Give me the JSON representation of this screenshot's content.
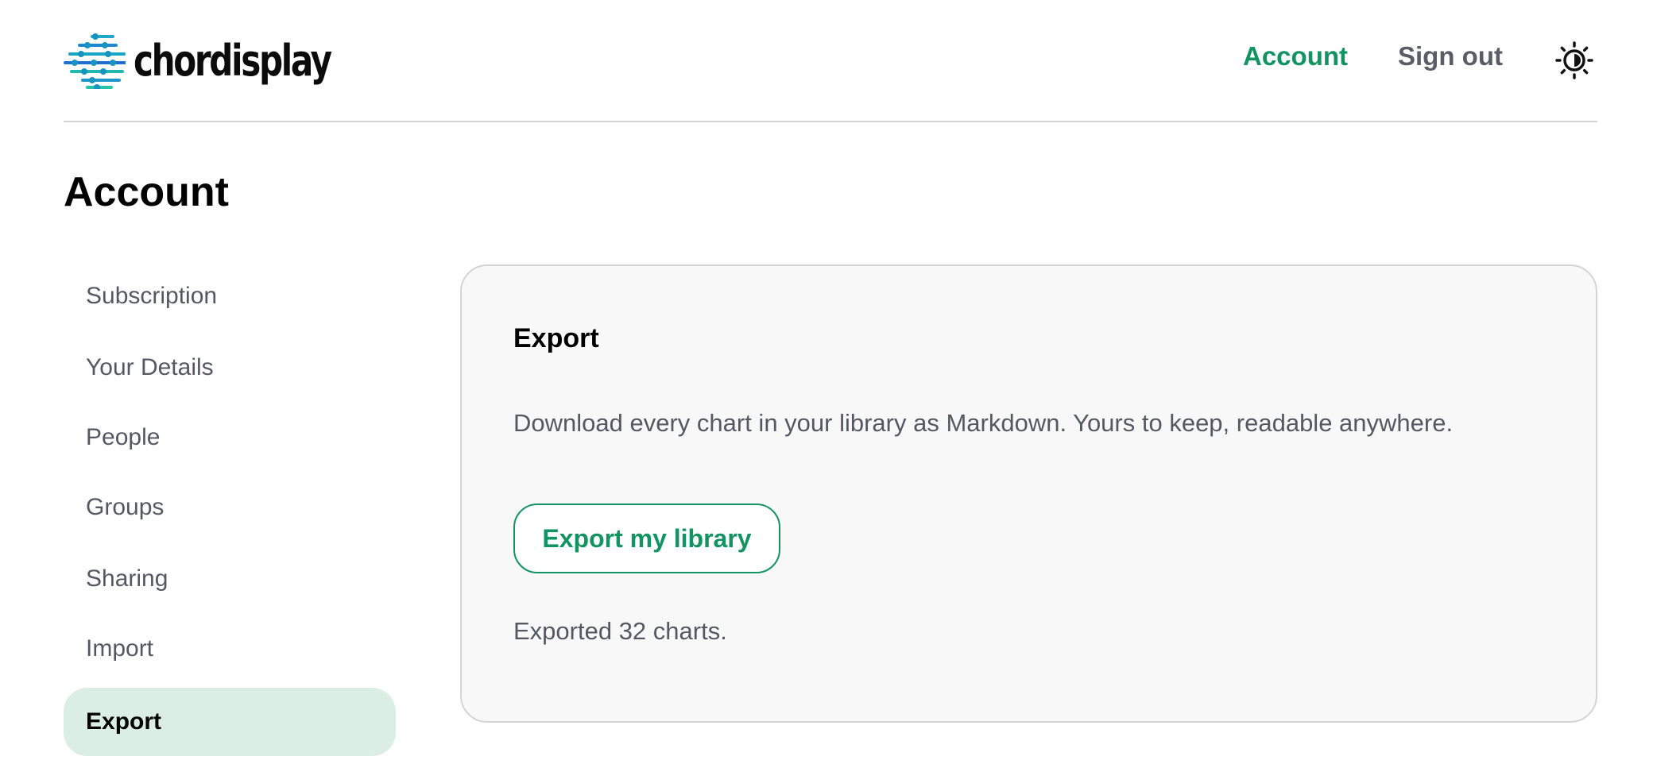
{
  "header": {
    "logo_text": "chordisplay",
    "logo_icon": "slider-lines-icon",
    "nav_account": "Account",
    "nav_signout": "Sign out",
    "theme_icon": "sun-moon-icon"
  },
  "page_title": "Account",
  "sidebar": {
    "items": [
      {
        "label": "Subscription",
        "active": false
      },
      {
        "label": "Your Details",
        "active": false
      },
      {
        "label": "People",
        "active": false
      },
      {
        "label": "Groups",
        "active": false
      },
      {
        "label": "Sharing",
        "active": false
      },
      {
        "label": "Import",
        "active": false
      },
      {
        "label": "Export",
        "active": true
      }
    ]
  },
  "export_card": {
    "title": "Export",
    "description": "Download every chart in your library as Markdown. Yours to keep, readable anywhere.",
    "button_label": "Export my library",
    "status": "Exported 32 charts."
  },
  "colors": {
    "accent": "#139262",
    "active_bg": "#dbeee6",
    "logo_blue": "#1f6fd1",
    "logo_teal": "#1fc1b0"
  }
}
